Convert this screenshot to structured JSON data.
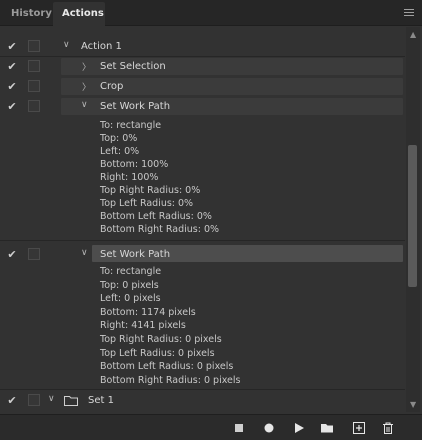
{
  "tabs": [
    {
      "label": "History",
      "active": false
    },
    {
      "label": "Actions",
      "active": true
    }
  ],
  "panel_menu_icon": "hamburger-menu-icon",
  "rows": [
    {
      "label": "Action 1",
      "checked": true,
      "expanded": true
    },
    {
      "label": "Set Selection",
      "checked": true,
      "expanded": false
    },
    {
      "label": "Crop",
      "checked": true,
      "expanded": false
    },
    {
      "label": "Set Work Path",
      "checked": true,
      "expanded": true,
      "params": [
        "To: rectangle",
        "Top: 0%",
        "Left: 0%",
        "Bottom: 100%",
        "Right: 100%",
        "Top Right Radius: 0%",
        "Top Left Radius: 0%",
        "Bottom Left Radius: 0%",
        "Bottom Right Radius: 0%"
      ]
    },
    {
      "label": "Set Work Path",
      "checked": true,
      "expanded": true,
      "selected": true,
      "params": [
        "To: rectangle",
        "Top: 0 pixels",
        "Left: 0 pixels",
        "Bottom: 1174 pixels",
        "Right: 4141 pixels",
        "Top Right Radius: 0 pixels",
        "Top Left Radius: 0 pixels",
        "Bottom Left Radius: 0 pixels",
        "Bottom Right Radius: 0 pixels"
      ]
    },
    {
      "label": "Set 1",
      "checked": true,
      "expanded": false,
      "folder": true
    }
  ],
  "toolbar": {
    "buttons": [
      "stop-icon",
      "record-icon",
      "play-icon",
      "folder-icon",
      "new-action-icon",
      "trash-icon"
    ]
  },
  "colors": {
    "panel": "#323232",
    "tabbar": "#262626",
    "selected_row": "#4d4d4d"
  }
}
